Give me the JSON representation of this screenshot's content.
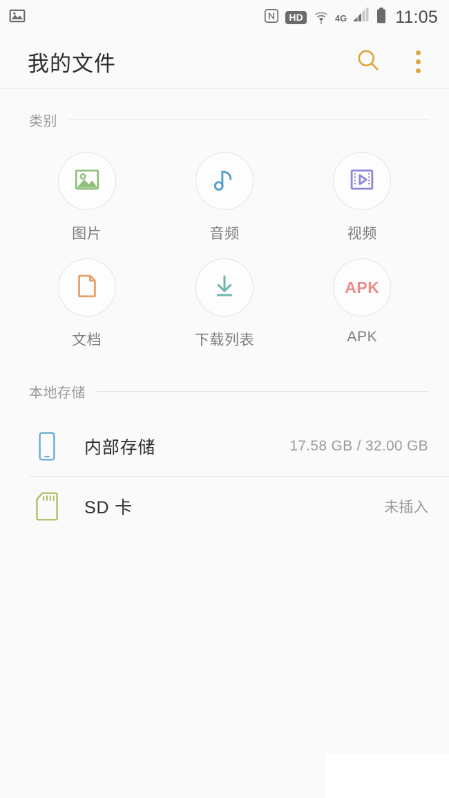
{
  "status_bar": {
    "left_icons": [
      {
        "name": "screenshot-image-icon",
        "label": "image"
      }
    ],
    "right_icons": [
      {
        "name": "nfc-icon",
        "label": "N"
      },
      {
        "name": "hd-voice-badge",
        "label": "HD"
      },
      {
        "name": "wifi-icon",
        "label": "wifi"
      },
      {
        "name": "mobile-network-label",
        "label": "4G"
      },
      {
        "name": "signal-bars-icon",
        "label": "signal"
      },
      {
        "name": "battery-icon",
        "label": "battery"
      }
    ],
    "clock": "11:05"
  },
  "app_bar": {
    "title": "我的文件",
    "search_icon": "search-icon",
    "overflow_icon": "more-options-icon"
  },
  "sections": {
    "categories": {
      "title": "类别",
      "items": [
        {
          "label": "图片",
          "icon": "image-icon",
          "color": "#8dc07a"
        },
        {
          "label": "音频",
          "icon": "music-note-icon",
          "color": "#57a0c9"
        },
        {
          "label": "视频",
          "icon": "video-icon",
          "color": "#8b85d6"
        },
        {
          "label": "文档",
          "icon": "document-icon",
          "color": "#e8a06a"
        },
        {
          "label": "下载列表",
          "icon": "download-icon",
          "color": "#6cb6ae"
        },
        {
          "label": "APK",
          "icon": "apk-icon",
          "color": "#ec8a8a"
        }
      ]
    },
    "local_storage": {
      "title": "本地存储",
      "items": [
        {
          "name": "内部存储",
          "meta": "17.58 GB / 32.00 GB",
          "icon": "phone-icon",
          "color": "#5fa8cf"
        },
        {
          "name": "SD 卡",
          "meta": "未插入",
          "icon": "sd-card-icon",
          "color": "#a9c064"
        }
      ]
    }
  },
  "theme": {
    "accent": "#dda83b",
    "background": "#fafafa",
    "primary_text": "#2e2e2e",
    "secondary_text": "#9b9b9b"
  }
}
